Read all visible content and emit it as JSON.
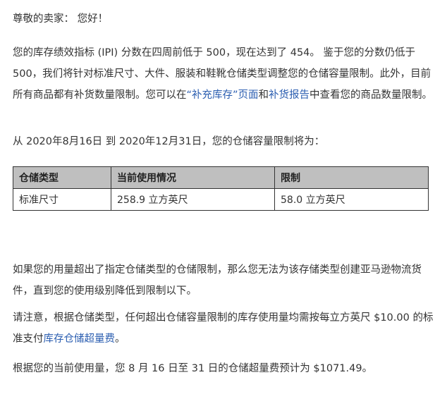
{
  "greeting": "尊敬的卖家： 您好！",
  "p1": {
    "text1": "您的库存绩效指标 (IPI) 分数在四周前低于 500，现在达到了 454。 鉴于您的分数仍低于 500，我们将针对标准尺寸、大件、服装和鞋靴仓储类型调整您的仓储容量限制。此外，目前所有商品都有补货数量限制。您可以在",
    "link1": "“补充库存”页面",
    "text2": "和",
    "link2": "补货报告",
    "text3": "中查看您的商品数量限制。"
  },
  "p2": "从 2020年8月16日 到 2020年12月31日，您的仓储容量限制将为：",
  "table": {
    "headers": [
      "仓储类型",
      "当前使用情况",
      "限制"
    ],
    "rows": [
      [
        "标准尺寸",
        "258.9 立方英尺",
        "58.0 立方英尺"
      ]
    ]
  },
  "p3": "如果您的用量超出了指定仓储类型的仓储限制，那么您无法为该存储类型创建亚马逊物流货件，直到您的使用级别降低到限制以下。",
  "p4": {
    "text1": "请注意，根据仓储类型，任何超出仓储容量限制的库存使用量均需按每立方英尺 $10.00 的标准支付",
    "link": "库存仓储超量费",
    "text2": "。"
  },
  "p5": "根据您的当前使用量，您 8 月 16 日至 31 日的仓储超量费预计为 $1071.49。",
  "colors": {
    "link": "#2a5db0",
    "header_bg": "#bfbfbf",
    "text": "#333333"
  }
}
